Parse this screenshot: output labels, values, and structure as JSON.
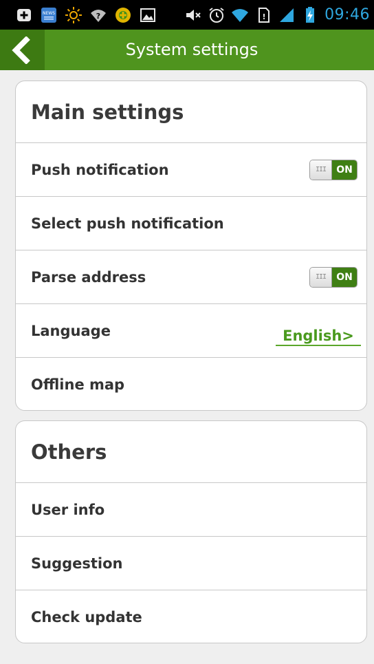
{
  "status_bar": {
    "icons": [
      "add-icon",
      "news-icon",
      "brightness-icon",
      "wifi-question-icon",
      "app-icon",
      "gallery-icon"
    ],
    "right_icons": [
      "mute-icon",
      "alarm-icon",
      "wifi-icon",
      "sim-icon",
      "signal-icon",
      "battery-charging-icon"
    ],
    "time": "09:46",
    "news_text": "NEWS"
  },
  "header": {
    "title": "System settings"
  },
  "main_settings": {
    "title": "Main settings",
    "items": [
      {
        "label": "Push notification",
        "toggle": "ON"
      },
      {
        "label": "Select push notification"
      },
      {
        "label": "Parse address",
        "toggle": "ON"
      },
      {
        "label": "Language",
        "value": "English>"
      },
      {
        "label": "Offline map"
      }
    ]
  },
  "others": {
    "title": "Others",
    "items": [
      {
        "label": "User info"
      },
      {
        "label": "Suggestion"
      },
      {
        "label": "Check update"
      }
    ]
  },
  "colors": {
    "accent": "#4f941e",
    "accent_dark": "#3d7a12",
    "toggle_on": "#3f7f14",
    "time": "#2fa7df"
  }
}
